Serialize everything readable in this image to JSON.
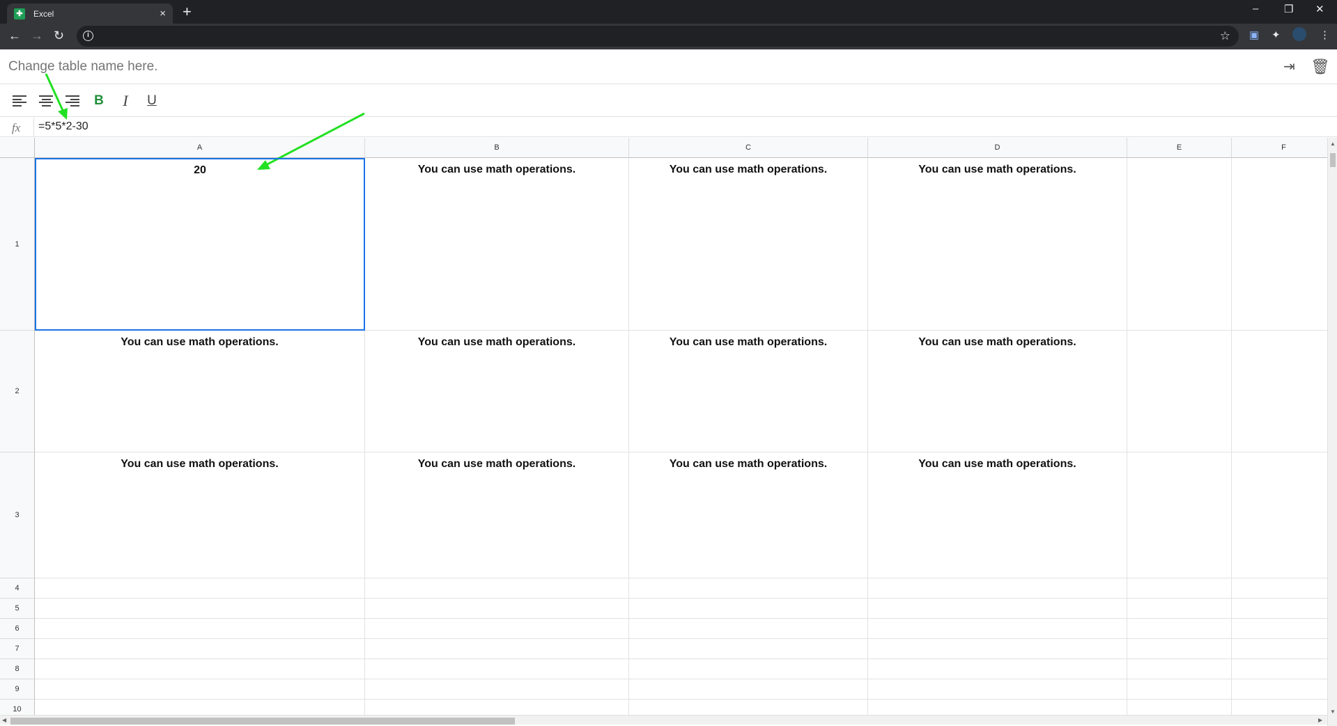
{
  "browser": {
    "tab_title": "Excel",
    "tab_close": "×",
    "new_tab": "+",
    "win_minimize": "–",
    "win_restore": "❐",
    "win_close": "✕"
  },
  "app": {
    "table_name_placeholder": "Change table name here.",
    "fx_label": "fx",
    "formula_value": "=5*5*2-30",
    "toolbar": {
      "bold": "B",
      "italic": "I",
      "underline": "U"
    },
    "columns": [
      "A",
      "B",
      "C",
      "D",
      "E",
      "F"
    ],
    "rows": [
      "1",
      "2",
      "3",
      "4",
      "5",
      "6",
      "7",
      "8",
      "9",
      "10"
    ],
    "cells": [
      [
        "20",
        "You can use math operations.",
        "You can use math operations.",
        "You can use math operations.",
        "",
        ""
      ],
      [
        "You can use math operations.",
        "You can use math operations.",
        "You can use math operations.",
        "You can use math operations.",
        "",
        ""
      ],
      [
        "You can use math operations.",
        "You can use math operations.",
        "You can use math operations.",
        "You can use math operations.",
        "",
        ""
      ]
    ],
    "selected_cell": "A1"
  },
  "annotation": {
    "arrow_color": "#22e022"
  },
  "colors": {
    "selection": "#1a73e8",
    "bold_accent": "#1f8f3a"
  }
}
